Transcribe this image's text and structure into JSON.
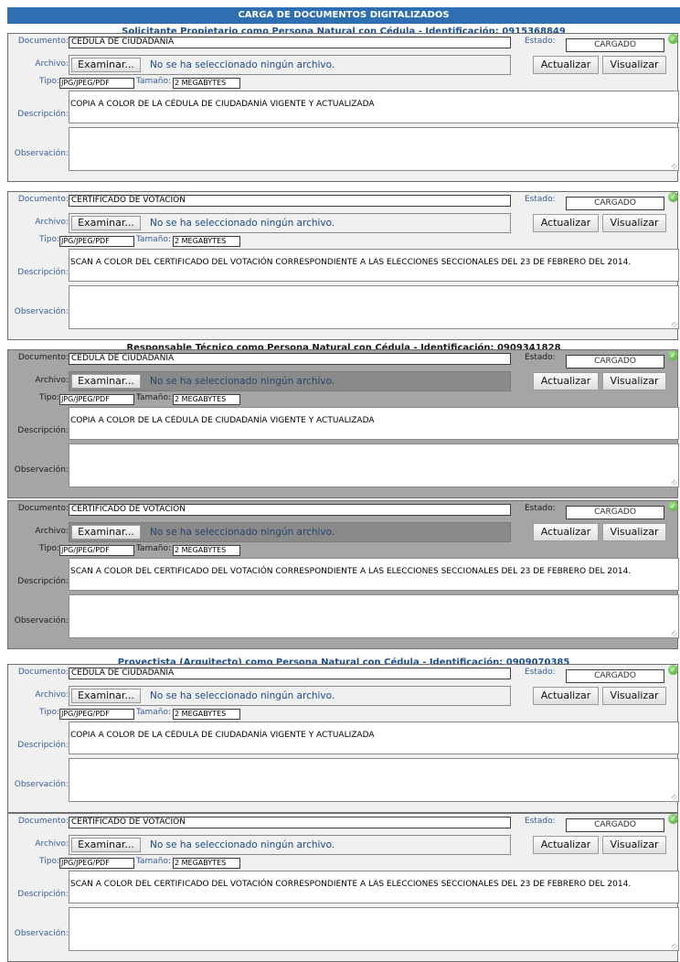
{
  "header": {
    "title": "CARGA DE DOCUMENTOS DIGITALIZADOS"
  },
  "labels": {
    "documento": "Documento:",
    "archivo": "Archivo:",
    "tipo": "Tipo:",
    "tamano": "Tamaño:",
    "descripcion": "Descripción:",
    "observacion": "Observación:",
    "estado": "Estado:"
  },
  "buttons": {
    "examinar": "Examinar...",
    "actualizar": "Actualizar",
    "visualizar": "Visualizar"
  },
  "file_placeholder": "No se ha seleccionado ningún archivo.",
  "sections": [
    {
      "title": "Solicitante Propietario como Persona Natural con Cédula - Identificación: 0915368849",
      "documents": [
        {
          "documento": "CÉDULA DE CIUDADANÍA",
          "estado": "CARGADO",
          "tipo": "JPG/JPEG/PDF",
          "tamano": "2 MEGABYTES",
          "descripcion": "COPIA A COLOR DE LA CÉDULA DE CIUDADANÍA VIGENTE Y ACTUALIZADA",
          "observacion": ""
        },
        {
          "documento": "CERTIFICADO DE VOTACIÓN",
          "estado": "CARGADO",
          "tipo": "JPG/JPEG/PDF",
          "tamano": "2 MEGABYTES",
          "descripcion": "SCAN A COLOR DEL CERTIFICADO DEL VOTACIÓN CORRESPONDIENTE A LAS ELECCIONES SECCIONALES DEL 23 DE FEBRERO DEL 2014.",
          "observacion": ""
        }
      ]
    },
    {
      "title": "Responsable Técnico como Persona Natural con Cédula - Identificación: 0909341828",
      "documents": [
        {
          "documento": "CÉDULA DE CIUDADANÍA",
          "estado": "CARGADO",
          "tipo": "JPG/JPEG/PDF",
          "tamano": "2 MEGABYTES",
          "descripcion": "COPIA A COLOR DE LA CÉDULA DE CIUDADANÍA VIGENTE Y ACTUALIZADA",
          "observacion": ""
        },
        {
          "documento": "CERTIFICADO DE VOTACIÓN",
          "estado": "CARGADO",
          "tipo": "JPG/JPEG/PDF",
          "tamano": "2 MEGABYTES",
          "descripcion": "SCAN A COLOR DEL CERTIFICADO DEL VOTACIÓN CORRESPONDIENTE A LAS ELECCIONES SECCIONALES DEL 23 DE FEBRERO DEL 2014.",
          "observacion": ""
        }
      ]
    },
    {
      "title": "Proyectista (Arquitecto) como Persona Natural con Cédula - Identificación: 0909070385",
      "documents": [
        {
          "documento": "CÉDULA DE CIUDADANÍA",
          "estado": "CARGADO",
          "tipo": "JPG/JPEG/PDF",
          "tamano": "2 MEGABYTES",
          "descripcion": "COPIA A COLOR DE LA CÉDULA DE CIUDADANÍA VIGENTE Y ACTUALIZADA",
          "observacion": ""
        },
        {
          "documento": "CERTIFICADO DE VOTACIÓN",
          "estado": "CARGADO",
          "tipo": "JPG/JPEG/PDF",
          "tamano": "2 MEGABYTES",
          "descripcion": "SCAN A COLOR DEL CERTIFICADO DEL VOTACIÓN CORRESPONDIENTE A LAS ELECCIONES SECCIONALES DEL 23 DE FEBRERO DEL 2014.",
          "observacion": ""
        }
      ]
    }
  ]
}
